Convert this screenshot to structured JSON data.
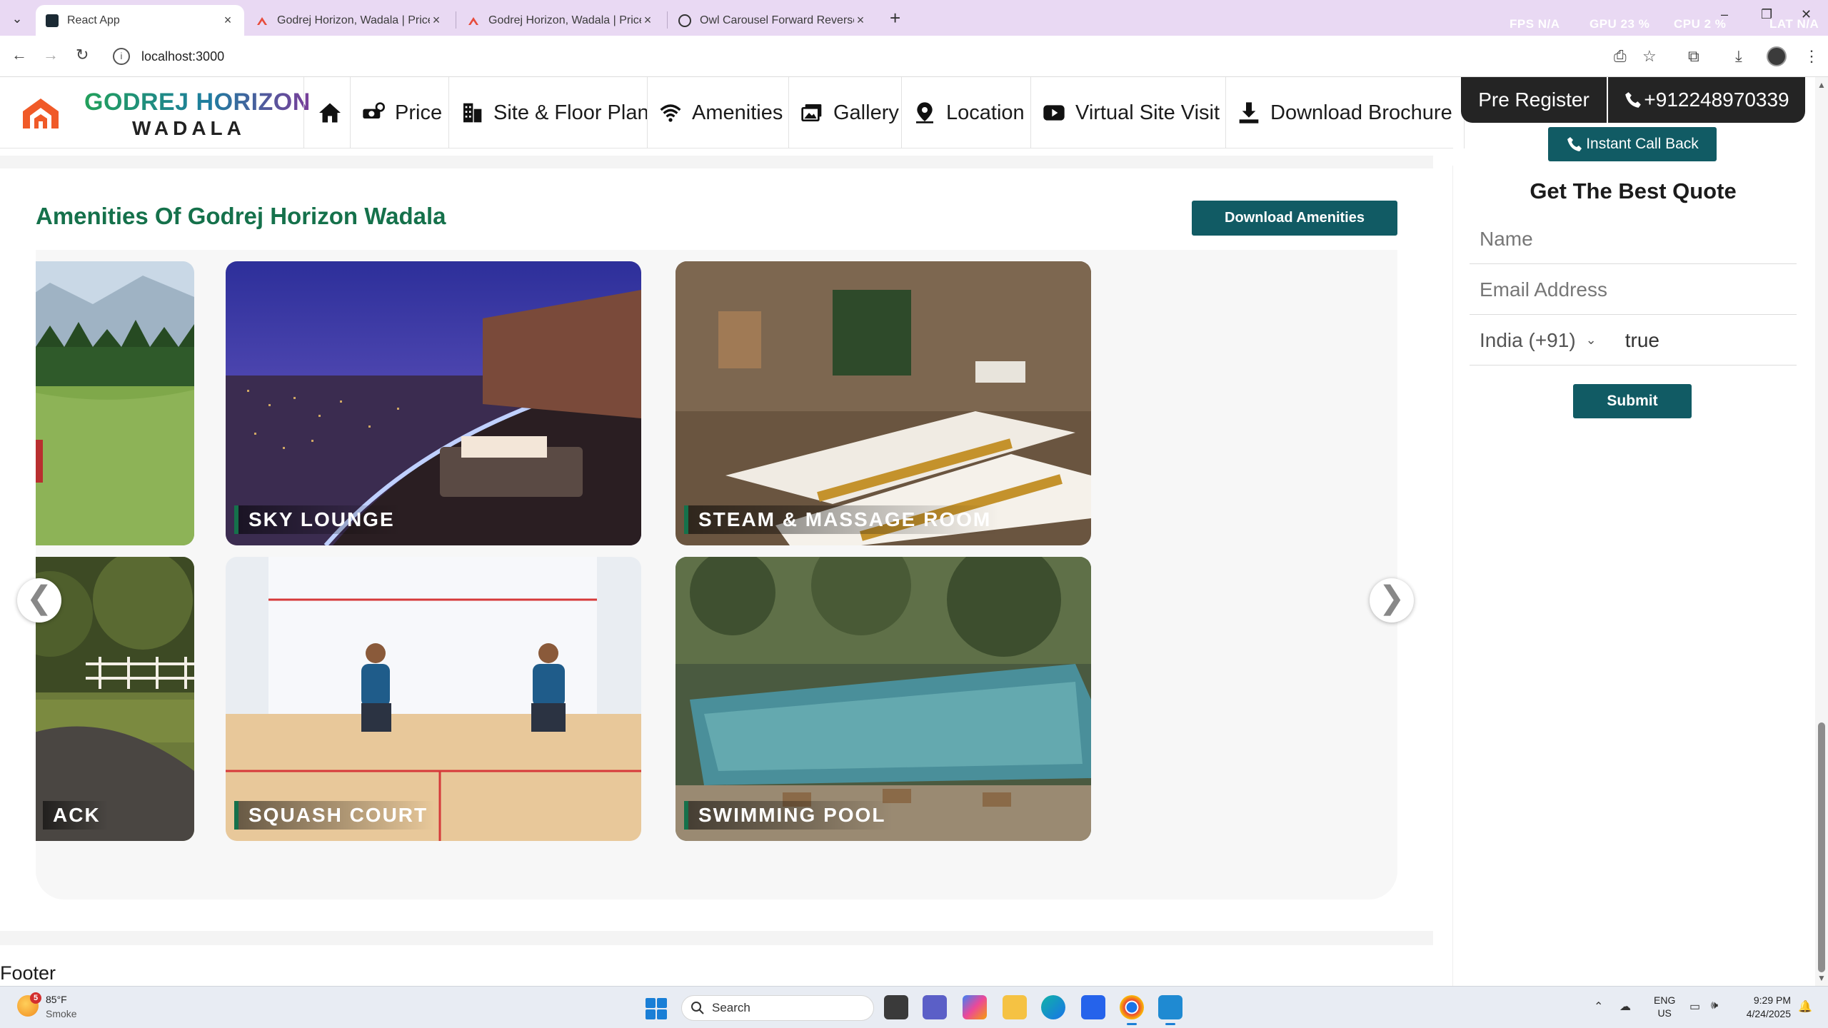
{
  "browser": {
    "tabs": [
      {
        "title": "React App",
        "active": true
      },
      {
        "title": "Godrej Horizon, Wadala | Price",
        "active": false
      },
      {
        "title": "Godrej Horizon, Wadala | Price",
        "active": false
      },
      {
        "title": "Owl Carousel Forward Reverse",
        "active": false
      }
    ],
    "perf": {
      "fps": "FPS  N/A",
      "gpu": "GPU  23 %",
      "cpu": "CPU  2 %",
      "lat": "LAT  N/A"
    },
    "url": "localhost:3000"
  },
  "header": {
    "brand_line1": "GODREJ HORIZON",
    "brand_line2": "WADALA",
    "nav": [
      {
        "label": "Price",
        "icon": "money-icon"
      },
      {
        "label": "Site & Floor Plan",
        "icon": "building-icon"
      },
      {
        "label": "Amenities",
        "icon": "wifi-icon"
      },
      {
        "label": "Gallery",
        "icon": "images-icon"
      },
      {
        "label": "Location",
        "icon": "map-pin-icon"
      },
      {
        "label": "Virtual Site Visit",
        "icon": "youtube-icon"
      },
      {
        "label": "Download Brochure",
        "icon": "download-icon"
      }
    ],
    "pre_register": "Pre Register",
    "phone": "+912248970339",
    "instant_call": "Instant Call Back"
  },
  "amenities": {
    "title": "Amenities Of Godrej Horizon Wadala",
    "download_label": "Download Amenities",
    "slides_top": [
      "",
      "SKY LOUNGE",
      "STEAM & MASSAGE ROOM"
    ],
    "slides_bottom": [
      "ACK",
      "SQUASH COURT",
      "SWIMMING POOL"
    ],
    "prev_arrow": "❮",
    "next_arrow": "❯"
  },
  "quote_form": {
    "title": "Get The Best Quote",
    "name_placeholder": "Name",
    "email_placeholder": "Email Address",
    "country": "India (+91)",
    "phone_value": "true",
    "submit": "Submit"
  },
  "footer": {
    "text": "Footer"
  },
  "taskbar": {
    "weather_badge": "5",
    "temperature": "85°F",
    "weather": "Smoke",
    "search_label": "Search",
    "lang_line1": "ENG",
    "lang_line2": "US",
    "time": "9:29 PM",
    "date": "4/24/2025"
  }
}
